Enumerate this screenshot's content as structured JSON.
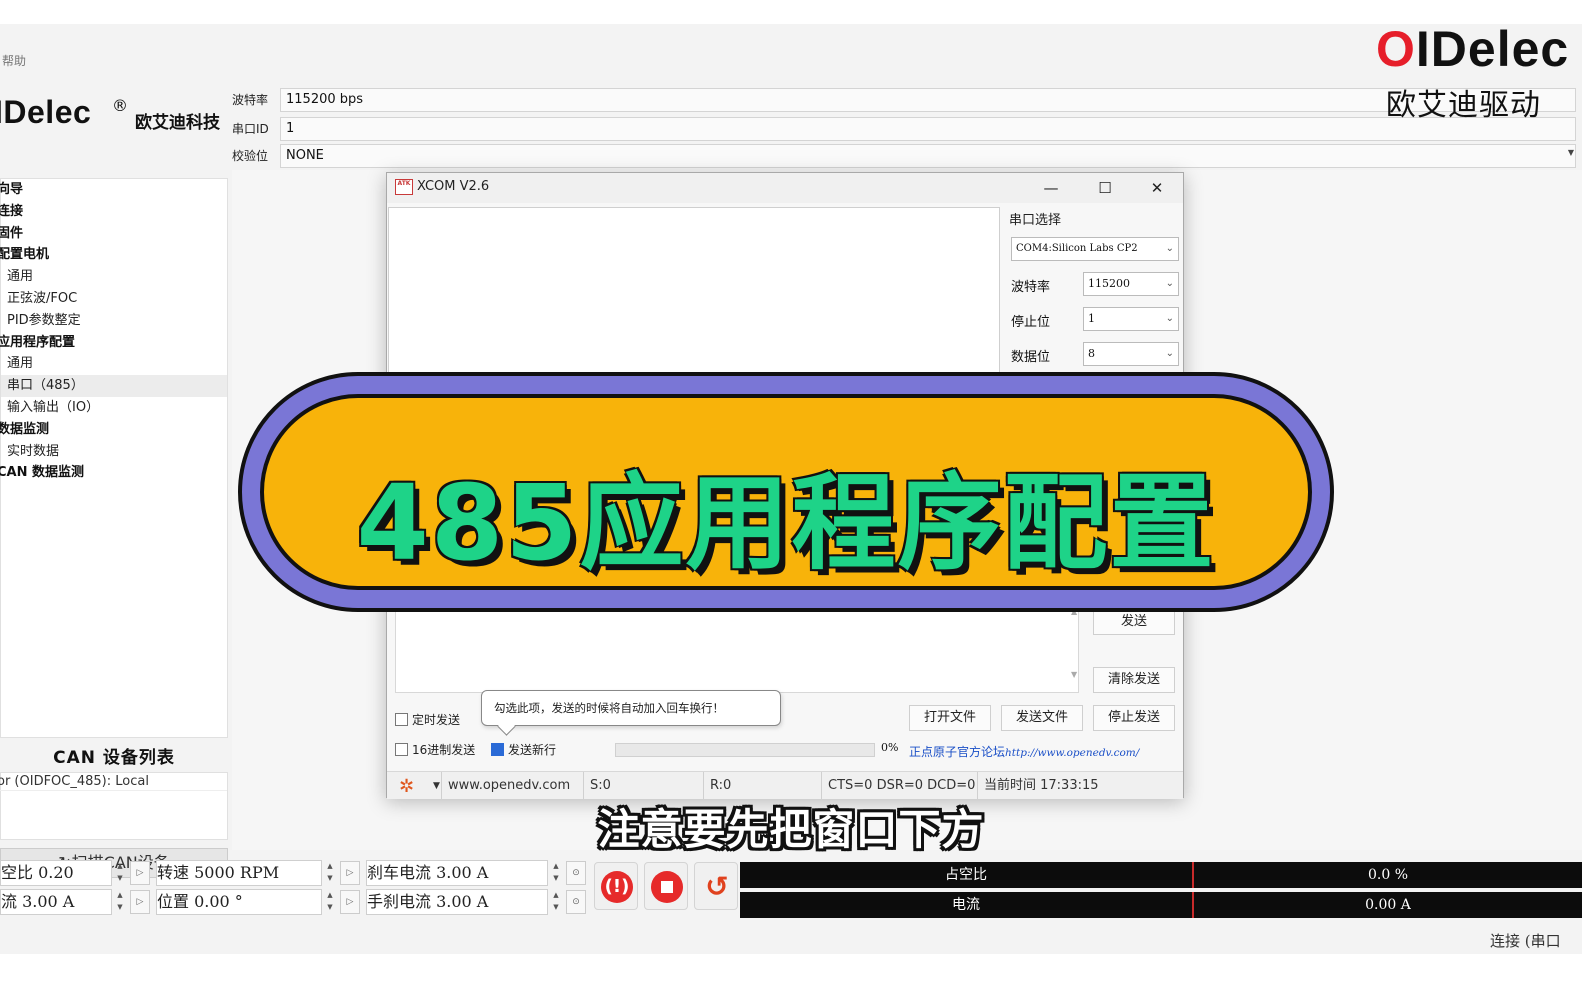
{
  "menu": {
    "help": "帮助"
  },
  "brand": {
    "logo": "IDelec",
    "reg": "®",
    "cn": "欧艾迪科技"
  },
  "watermark": {
    "logo_o": "O",
    "logo_rest": "IDelec",
    "cn": "欧艾迪驱动",
    "logo_color": "#e61e2a"
  },
  "nav": {
    "items": [
      {
        "label": "向导",
        "kind": "parent"
      },
      {
        "label": "连接",
        "kind": "parent"
      },
      {
        "label": "固件",
        "kind": "parent"
      },
      {
        "label": "配置电机",
        "kind": "parent"
      },
      {
        "label": "通用",
        "kind": "child"
      },
      {
        "label": "正弦波/FOC",
        "kind": "child"
      },
      {
        "label": "PID参数整定",
        "kind": "child"
      },
      {
        "label": "应用程序配置",
        "kind": "parent"
      },
      {
        "label": "通用",
        "kind": "child"
      },
      {
        "label": "串口（485）",
        "kind": "child",
        "selected": true
      },
      {
        "label": "输入输出（IO）",
        "kind": "child"
      },
      {
        "label": "数据监测",
        "kind": "parent"
      },
      {
        "label": "实时数据",
        "kind": "child"
      },
      {
        "label": "CAN 数据监测",
        "kind": "parent"
      }
    ]
  },
  "can_panel": {
    "title": "CAN 设备列表",
    "device": "or (OIDFOC_485): Local",
    "scan_button": "扫描CAN设备"
  },
  "props": {
    "baud_label": "波特率",
    "baud_value": "115200 bps",
    "port_label": "串口ID",
    "port_value": "1",
    "parity_label": "校验位",
    "parity_value": "NONE"
  },
  "xcom": {
    "title": "XCOM V2.6",
    "icon_text": "ATK",
    "port_select_title": "串口选择",
    "port_value": "COM4:Silicon Labs CP2",
    "baud_label": "波特率",
    "baud_value": "115200",
    "stop_label": "停止位",
    "stop_value": "1",
    "data_label": "数据位",
    "data_value": "8",
    "send_btn": "发送",
    "clear_send_btn": "清除发送",
    "open_file_btn": "打开文件",
    "send_file_btn": "发送文件",
    "stop_send_btn": "停止发送",
    "timed_send": "定时发送",
    "hex_send": "16进制发送",
    "send_newline": "发送新行",
    "tooltip": "勾选此项，发送的时候将自动加入回车换行！",
    "percent": "0%",
    "forum_label": "正点原子官方论坛",
    "forum_url": "http://www.openedv.com/",
    "status": {
      "site": "www.openedv.com",
      "s": "S:0",
      "r": "R:0",
      "lines": "CTS=0 DSR=0 DCD=0",
      "time": "当前时间 17:33:15"
    }
  },
  "banner": {
    "text": "485应用程序配置",
    "fill": "#f8b30a",
    "ring": "#7a76d6",
    "text_color": "#1ed388"
  },
  "subtitle": "注意要先把窗口下方",
  "controls": {
    "duty": "空比 0.20",
    "current": "流 3.00 A",
    "speed": "转速 5000 RPM",
    "position": "位置 0.00 °",
    "brake_current": "刹车电流 3.00 A",
    "handbrake_current": "手刹电流 3.00 A"
  },
  "meters": [
    {
      "label": "占空比",
      "value": "0.0 %"
    },
    {
      "label": "电流",
      "value": "0.00 A"
    }
  ],
  "footer": {
    "status": "连接 (串口"
  }
}
